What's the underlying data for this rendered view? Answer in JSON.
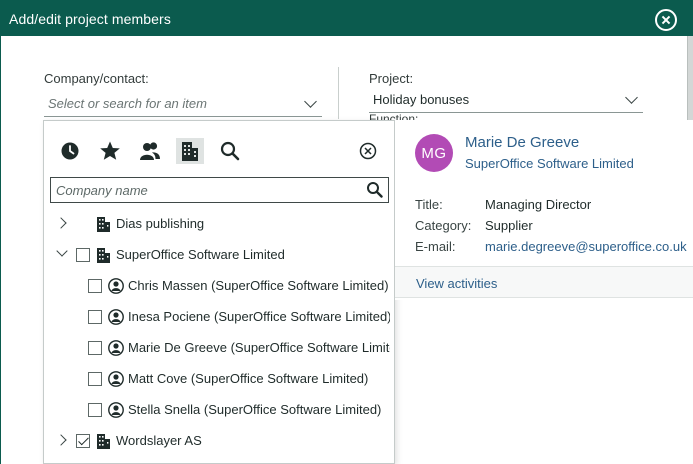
{
  "dialog": {
    "title": "Add/edit project members"
  },
  "form": {
    "company_label": "Company/contact:",
    "company_placeholder": "Select or search for an item",
    "project_label": "Project:",
    "project_value": "Holiday bonuses",
    "function_label": "Function:"
  },
  "picker": {
    "tabs": [
      {
        "name": "recent",
        "icon": "clock-icon"
      },
      {
        "name": "favorites",
        "icon": "star-icon"
      },
      {
        "name": "contacts",
        "icon": "people-icon"
      },
      {
        "name": "companies",
        "icon": "building-icon",
        "active": true
      },
      {
        "name": "search",
        "icon": "search-icon"
      }
    ],
    "search_placeholder": "Company name",
    "rows": [
      {
        "label": "Dias publishing",
        "kind": "company",
        "expanded": false,
        "checkbox": false
      },
      {
        "label": "SuperOffice Software Limited",
        "kind": "company",
        "expanded": true,
        "checkbox": true,
        "checked": false
      },
      {
        "label": "Chris Massen (SuperOffice Software Limited)",
        "kind": "person",
        "checked": false
      },
      {
        "label": "Inesa Pociene (SuperOffice Software Limited)",
        "kind": "person",
        "checked": false
      },
      {
        "label": "Marie De Greeve (SuperOffice Software Limited)",
        "kind": "person",
        "checked": false
      },
      {
        "label": "Matt Cove (SuperOffice Software Limited)",
        "kind": "person",
        "checked": false
      },
      {
        "label": "Stella Snella (SuperOffice Software Limited)",
        "kind": "person",
        "checked": false
      },
      {
        "label": "Wordslayer AS",
        "kind": "company",
        "expanded": false,
        "checkbox": true,
        "checked": true
      }
    ]
  },
  "card": {
    "initials": "MG",
    "avatar_color": "#b24bb5",
    "name": "Marie De Greeve",
    "company": "SuperOffice Software Limited",
    "title_label": "Title:",
    "title_value": "Managing Director",
    "category_label": "Category:",
    "category_value": "Supplier",
    "email_label": "E-mail:",
    "email_value": "marie.degreeve@superoffice.co.uk",
    "view_activities": "View activities"
  },
  "colors": {
    "titlebar": "#0b5b4e",
    "link": "#2d5f8a"
  }
}
